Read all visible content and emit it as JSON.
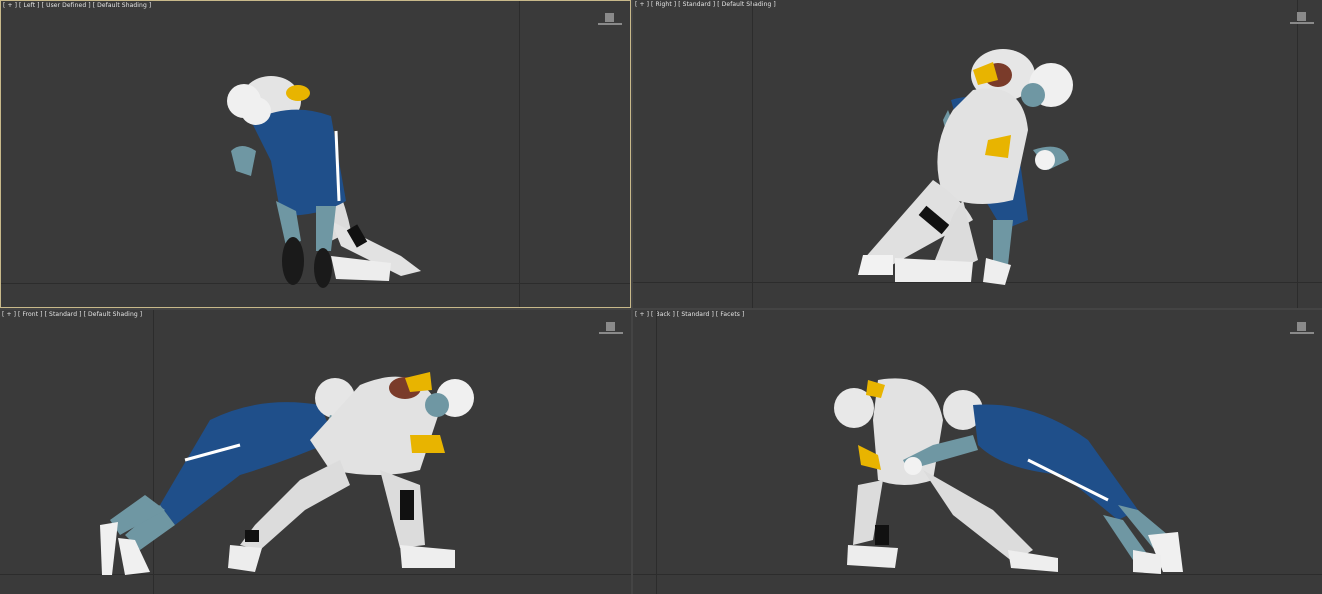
{
  "viewports": [
    {
      "id": "left",
      "labels": [
        "[ + ]",
        "[ Left ]",
        "[ User Defined ]",
        "[ Default Shading ]"
      ],
      "active": true
    },
    {
      "id": "right",
      "labels": [
        "[ + ]",
        "[ Right ]",
        "[ Standard ]",
        "[ Default Shading ]"
      ],
      "active": false
    },
    {
      "id": "front",
      "labels": [
        "[ + ]",
        "[ Front ]",
        "[ Standard ]",
        "[ Default Shading ]"
      ],
      "active": false
    },
    {
      "id": "back",
      "labels": [
        "[ + ]",
        "[ Back ]",
        "[ Standard ]",
        "[ Facets ]"
      ],
      "active": false
    }
  ],
  "colors": {
    "viewport_bg": "#3a3a3a",
    "active_border": "#c8b98a",
    "grid_line": "#2c2c2c",
    "jersey_blue": "#1f4f8a",
    "skin_teal": "#6f97a3",
    "uniform_white": "#e8e8e8",
    "glove_yellow": "#e8b400",
    "ball_brown": "#7a3b2a"
  },
  "icons": {
    "nav_cube": "viewcube-icon"
  }
}
